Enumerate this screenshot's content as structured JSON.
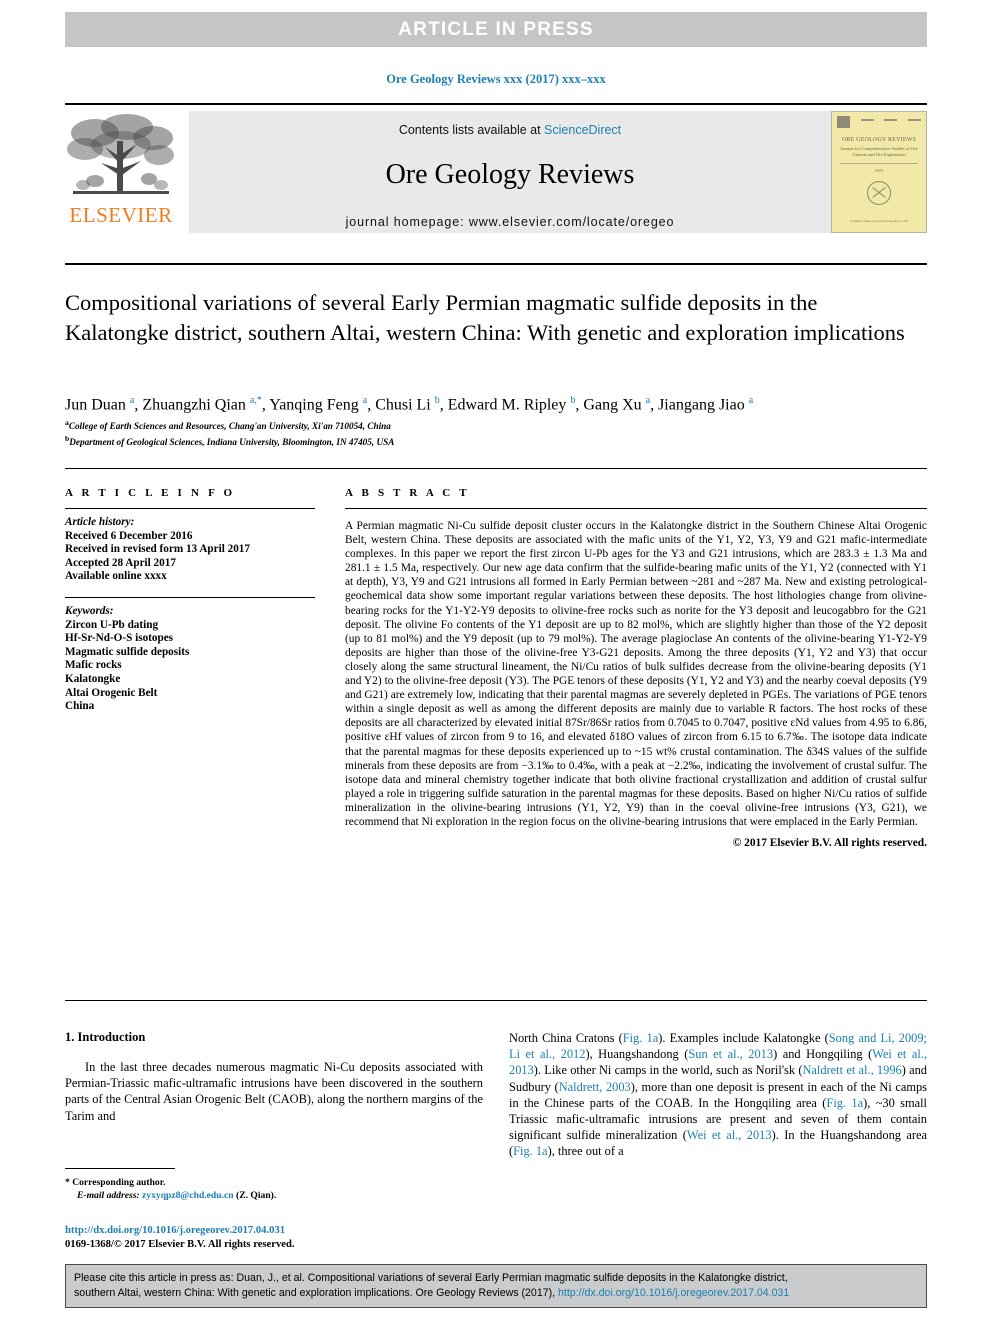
{
  "banner": {
    "text": "ARTICLE  IN  PRESS"
  },
  "running_head": {
    "text": "Ore Geology Reviews xxx (2017) xxx–xxx"
  },
  "masthead": {
    "contents_prefix": "Contents lists available at ",
    "sciencedirect": "ScienceDirect",
    "journal_name": "Ore Geology Reviews",
    "homepage": "journal homepage: www.elsevier.com/locate/oregeo",
    "publisher_wordmark": "ELSEVIER",
    "cover": {
      "title": "ORE GEOLOGY REVIEWS",
      "subtitle": "Journal for Comprehensive Studies of\nOre Genesis and Ore Exploration",
      "tiny": "ISSN",
      "footline": "available online at www.sciencedirect.com"
    }
  },
  "article": {
    "title": "Compositional variations of several Early Permian magmatic sulfide deposits in the Kalatongke district, southern Altai, western China: With genetic and exploration implications",
    "authors": "Jun Duan a, Zhuangzhi Qian a,*, Yanqing Feng a, Chusi Li b, Edward M. Ripley b, Gang Xu a, Jiangang Jiao a",
    "affiliations": [
      "a College of Earth Sciences and Resources, Chang'an University, Xi'an 710054, China",
      "b Department of Geological Sciences, Indiana University, Bloomington, IN 47405, USA"
    ]
  },
  "article_info": {
    "heading": "A R T I C L E   I N F O",
    "history_label": "Article history:",
    "history": [
      "Received 6 December 2016",
      "Received in revised form 13 April 2017",
      "Accepted 28 April 2017",
      "Available online xxxx"
    ],
    "keywords_label": "Keywords:",
    "keywords": [
      "Zircon U-Pb dating",
      "Hf-Sr-Nd-O-S isotopes",
      "Magmatic sulfide deposits",
      "Mafic rocks",
      "Kalatongke",
      "Altai Orogenic Belt",
      "China"
    ]
  },
  "abstract": {
    "heading": "A B S T R A C T",
    "text": "A Permian magmatic Ni-Cu sulfide deposit cluster occurs in the Kalatongke district in the Southern Chinese Altai Orogenic Belt, western China. These deposits are associated with the mafic units of the Y1, Y2, Y3, Y9 and G21 mafic-intermediate complexes. In this paper we report the first zircon U-Pb ages for the Y3 and G21 intrusions, which are 283.3 ± 1.3 Ma and 281.1 ± 1.5 Ma, respectively. Our new age data confirm that the sulfide-bearing mafic units of the Y1, Y2 (connected with Y1 at depth), Y3, Y9 and G21 intrusions all formed in Early Permian between ~281 and ~287 Ma. New and existing petrological-geochemical data show some important regular variations between these deposits. The host lithologies change from olivine-bearing rocks for the Y1-Y2-Y9 deposits to olivine-free rocks such as norite for the Y3 deposit and leucogabbro for the G21 deposit. The olivine Fo contents of the Y1 deposit are up to 82 mol%, which are slightly higher than those of the Y2 deposit (up to 81 mol%) and the Y9 deposit (up to 79 mol%). The average plagioclase An contents of the olivine-bearing Y1-Y2-Y9 deposits are higher than those of the olivine-free Y3-G21 deposits. Among the three deposits (Y1, Y2 and Y3) that occur closely along the same structural lineament, the Ni/Cu ratios of bulk sulfides decrease from the olivine-bearing deposits (Y1 and Y2) to the olivine-free deposit (Y3). The PGE tenors of these deposits (Y1, Y2 and Y3) and the nearby coeval deposits (Y9 and G21) are extremely low, indicating that their parental magmas are severely depleted in PGEs. The variations of PGE tenors within a single deposit as well as among the different deposits are mainly due to variable R factors. The host rocks of these deposits are all characterized by elevated initial 87Sr/86Sr ratios from 0.7045 to 0.7047, positive εNd values from 4.95 to 6.86, positive εHf values of zircon from 9 to 16, and elevated δ18O values of zircon from 6.15 to 6.7‰. The isotope data indicate that the parental magmas for these deposits experienced up to ~15 wt% crustal contamination. The δ34S values of the sulfide minerals from these deposits are from −3.1‰ to 0.4‰, with a peak at −2.2‰, indicating the involvement of crustal sulfur. The isotope data and mineral chemistry together indicate that both olivine fractional crystallization and addition of crustal sulfur played a role in triggering sulfide saturation in the parental magmas for these deposits. Based on higher Ni/Cu ratios of sulfide mineralization in the olivine-bearing intrusions (Y1, Y2, Y9) than in the coeval olivine-free intrusions (Y3, G21), we recommend that Ni exploration in the region focus on the olivine-bearing intrusions that were emplaced in the Early Permian.",
    "copyright": "© 2017 Elsevier B.V. All rights reserved."
  },
  "introduction": {
    "heading": "1. Introduction",
    "left_paragraph": "In the last three decades numerous magmatic Ni-Cu deposits associated with Permian-Triassic mafic-ultramafic intrusions have been discovered in the southern parts of the Central Asian Orogenic Belt (CAOB), along the northern margins of the Tarim and",
    "right_paragraph_parts": [
      "North China Cratons (",
      "Fig. 1a",
      "). Examples include Kalatongke (",
      "Song and Li, 2009; Li et al., 2012",
      "), Huangshandong (",
      "Sun et al., 2013",
      ") and Hongqiling (",
      "Wei et al., 2013",
      "). Like other Ni camps in the world, such as Noril'sk (",
      "Naldrett et al., 1996",
      ") and Sudbury (",
      "Naldrett, 2003",
      "), more than one deposit is present in each of the Ni camps in the Chinese parts of the COAB. In the Hongqiling area (",
      "Fig. 1a",
      "), ~30 small Triassic mafic-ultramafic intrusions are present and seven of them contain significant sulfide mineralization (",
      "Wei et al., 2013",
      "). In the Huangshandong area (",
      "Fig. 1a",
      "), three out of a"
    ]
  },
  "footnotes": {
    "corresponding_marker": "*",
    "corresponding_label": "Corresponding author.",
    "email_label": "E-mail address:",
    "email": "zyxyqpz8@chd.edu.cn",
    "email_suffix": "(Z. Qian)."
  },
  "doi_block": {
    "doi_url": "http://dx.doi.org/10.1016/j.oregeorev.2017.04.031",
    "issn_line": "0169-1368/© 2017 Elsevier B.V. All rights reserved."
  },
  "cite_box": {
    "line1": "Please cite this article in press as: Duan, J., et al. Compositional variations of several Early Permian magmatic sulfide deposits in the Kalatongke district,",
    "line2_text": "southern Altai, western China: With genetic and exploration implications. Ore Geology Reviews (2017), ",
    "line2_link": "http://dx.doi.org/10.1016/j.oregeorev.2017.04.031"
  },
  "colors": {
    "link": "#1a7fb3",
    "banner_bg": "#c3c5c7",
    "elsevier_orange": "#ef7d20",
    "masthead_bg": "#e9e9e9",
    "cite_bg": "#c9cbcd"
  }
}
